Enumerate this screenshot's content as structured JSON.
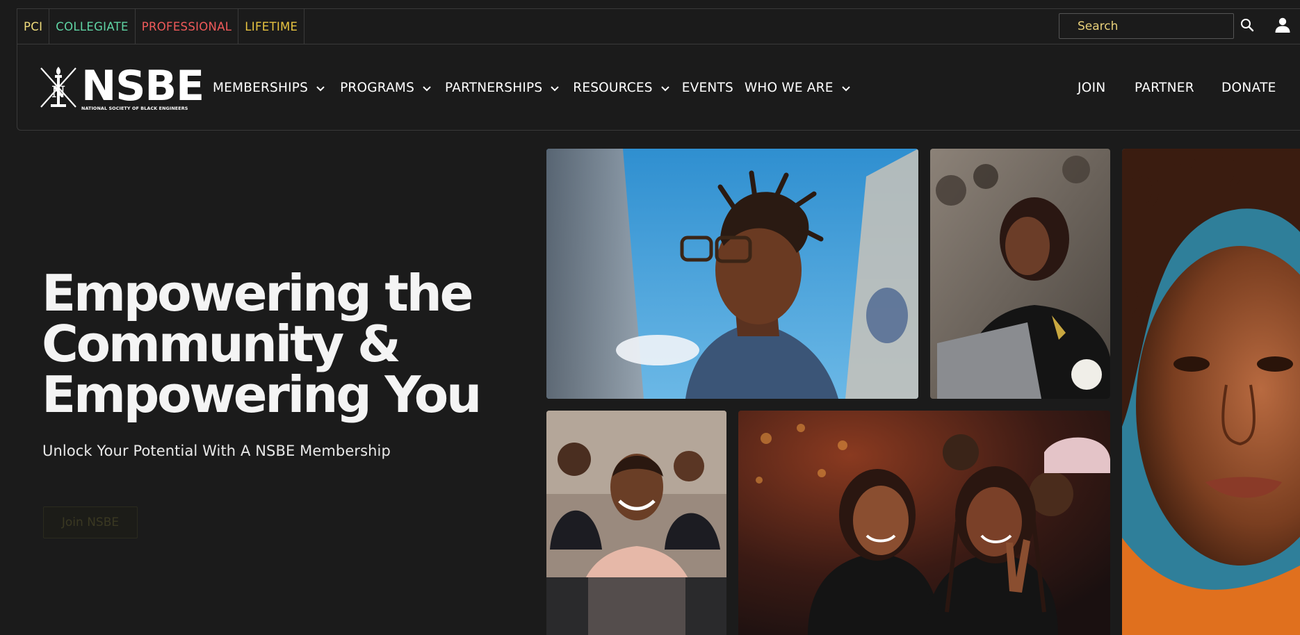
{
  "membership_tabs": [
    {
      "label": "PCI",
      "color": "#f0dc7c"
    },
    {
      "label": "COLLEGIATE",
      "color": "#5fd4a4"
    },
    {
      "label": "PROFESSIONAL",
      "color": "#f05a5a"
    },
    {
      "label": "LIFETIME",
      "color": "#e8c440"
    }
  ],
  "search": {
    "placeholder": "Search"
  },
  "logo": {
    "name": "NSBE",
    "subtitle": "NATIONAL SOCIETY OF BLACK ENGINEERS"
  },
  "nav": {
    "items": [
      {
        "label": "MEMBERSHIPS",
        "dropdown": true
      },
      {
        "label": "PROGRAMS",
        "dropdown": true
      },
      {
        "label": "PARTNERSHIPS",
        "dropdown": true
      },
      {
        "label": "RESOURCES",
        "dropdown": true
      },
      {
        "label": "EVENTS",
        "dropdown": false
      },
      {
        "label": "WHO WE ARE",
        "dropdown": true
      }
    ],
    "join": "JOIN",
    "partner": "PARTNER",
    "donate": "DONATE"
  },
  "hero": {
    "title_line1": "Empowering the",
    "title_line2": "Community &",
    "title_line3": "Empowering You",
    "subtitle": "Unlock Your Potential With A NSBE Membership",
    "cta": "Join NSBE"
  },
  "icons": {
    "search": "search-icon",
    "user": "user-icon",
    "chevron": "chevron-down-icon"
  },
  "colors": {
    "background": "#1b1b1b",
    "border": "#3a3a3a",
    "search_text": "#e8d07a"
  }
}
